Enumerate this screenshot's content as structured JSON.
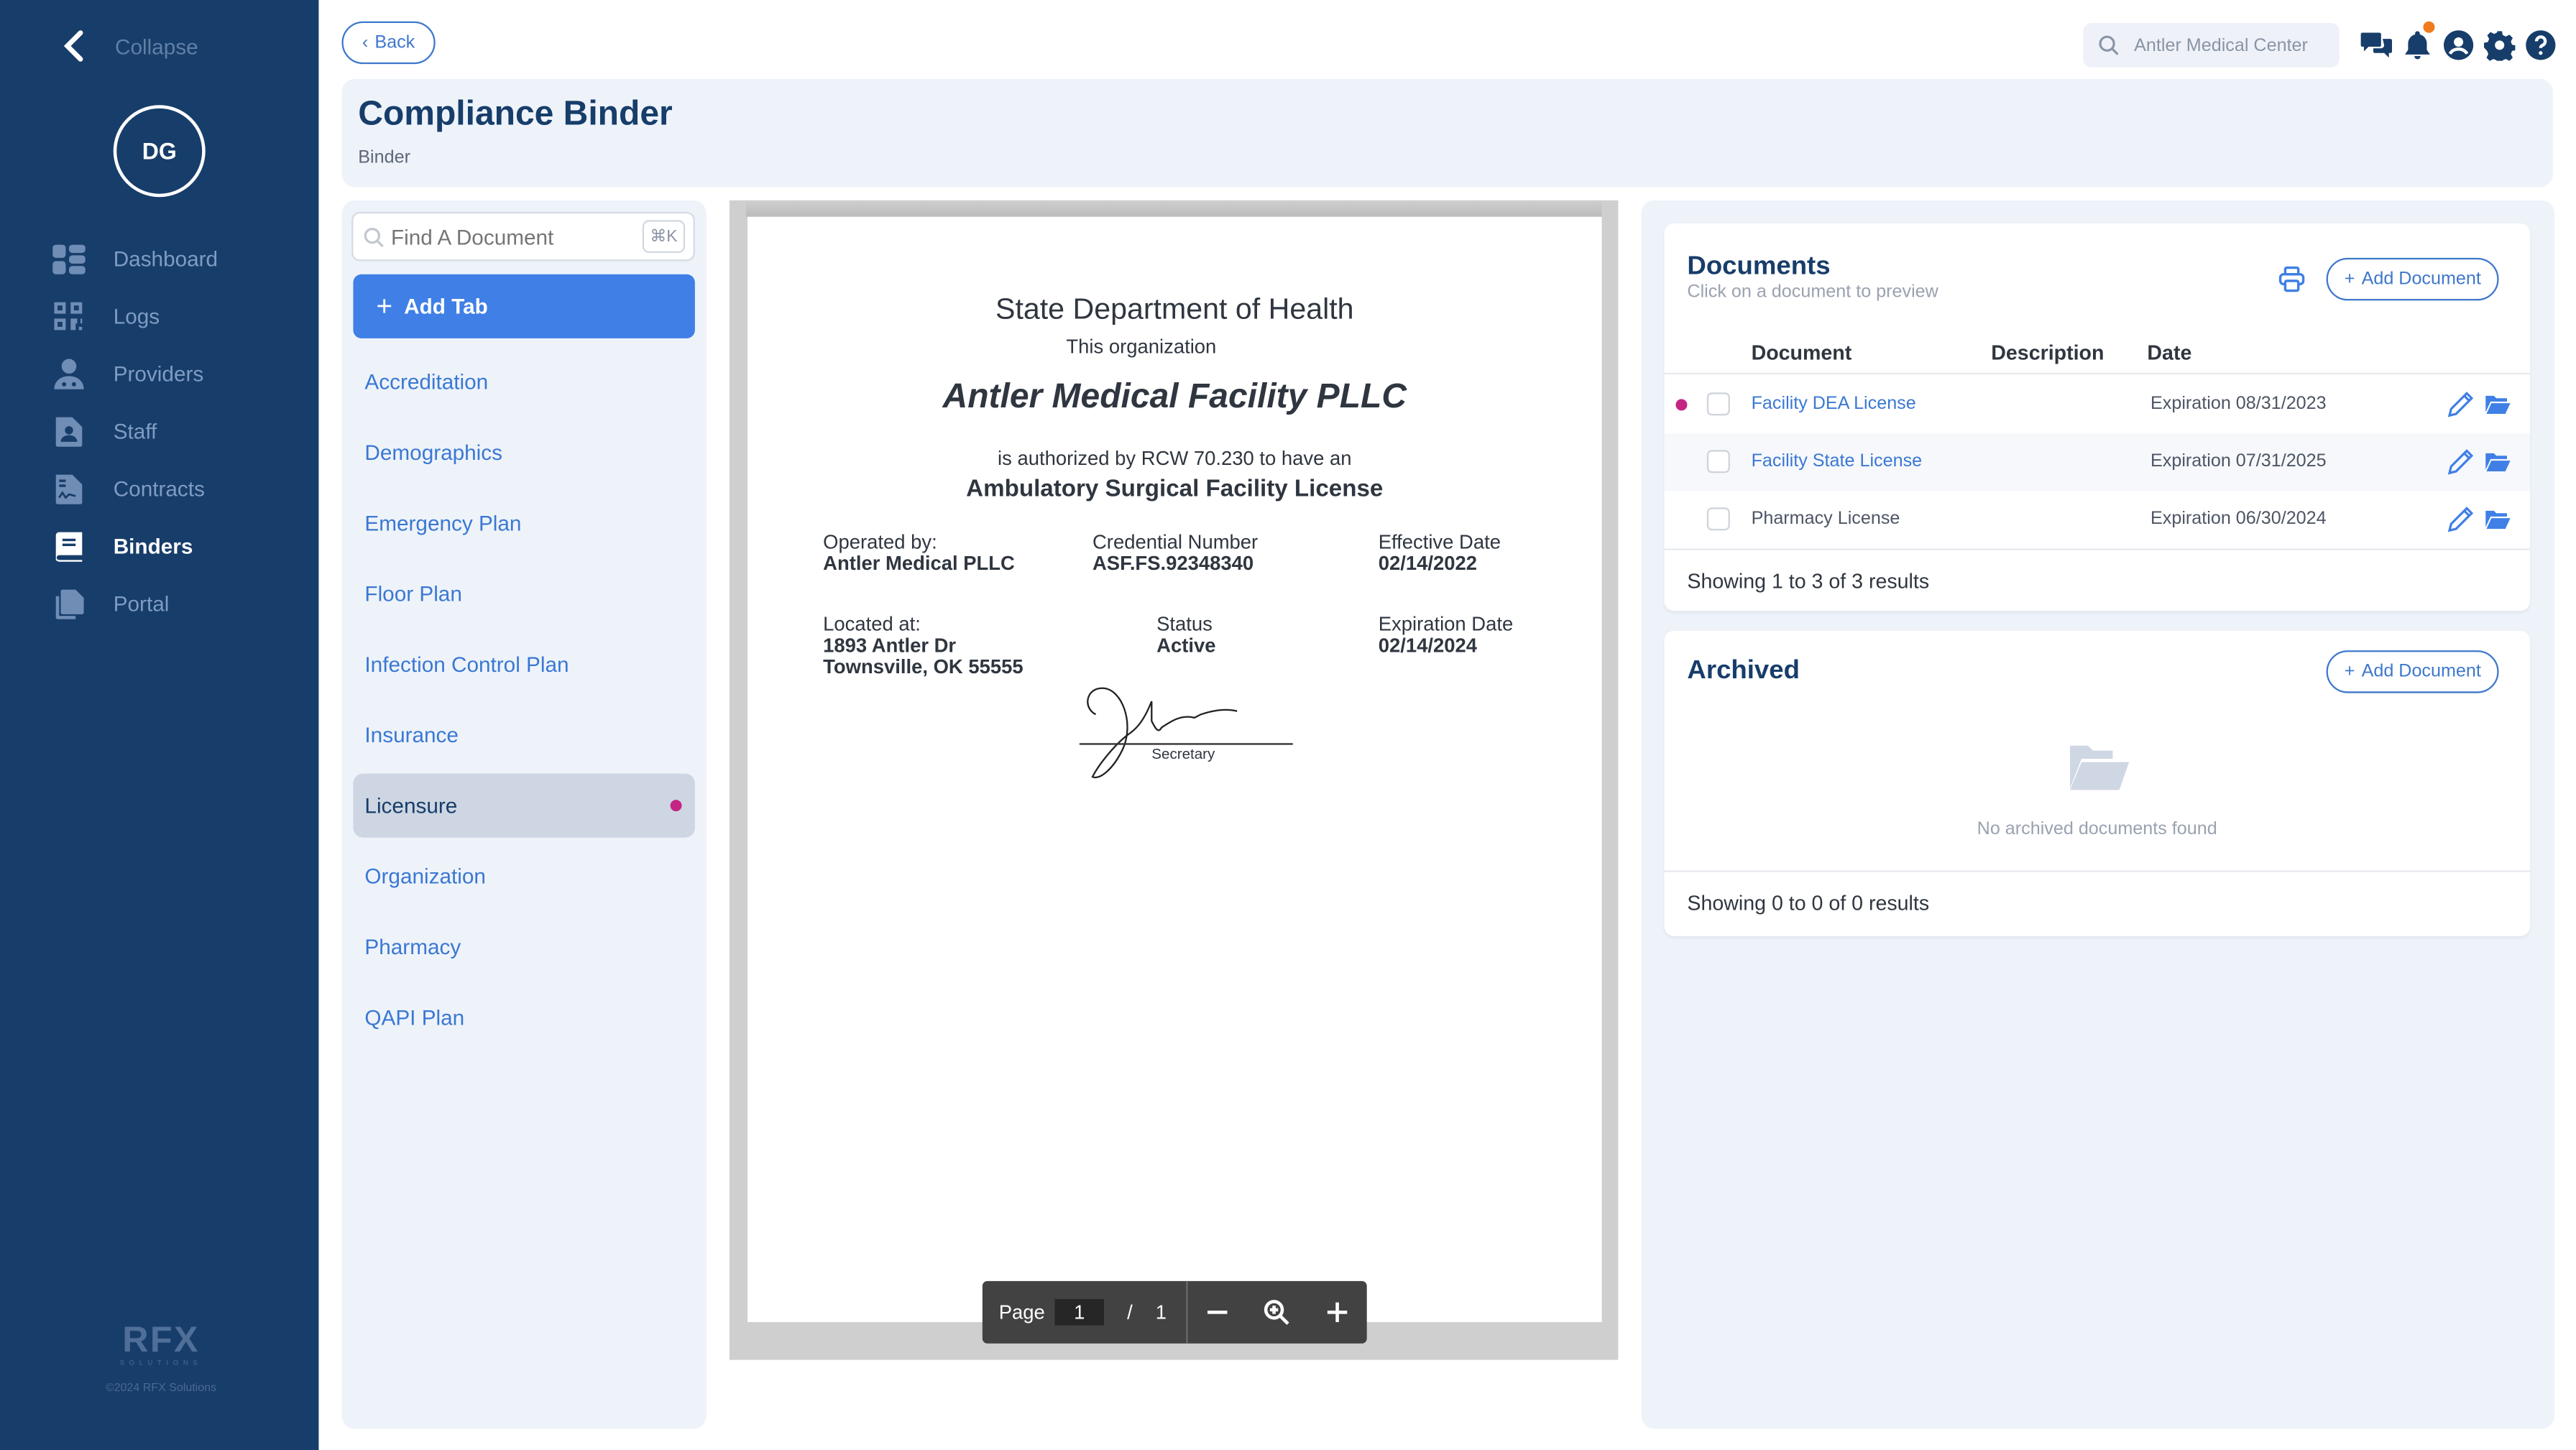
{
  "sidebar": {
    "collapse_label": "Collapse",
    "avatar_initials": "DG",
    "items": [
      {
        "label": "Dashboard",
        "icon": "dashboard-icon",
        "active": false
      },
      {
        "label": "Logs",
        "icon": "qr-code-icon",
        "active": false
      },
      {
        "label": "Providers",
        "icon": "doctor-icon",
        "active": false
      },
      {
        "label": "Staff",
        "icon": "file-user-icon",
        "active": false
      },
      {
        "label": "Contracts",
        "icon": "file-signature-icon",
        "active": false
      },
      {
        "label": "Binders",
        "icon": "book-icon",
        "active": true
      },
      {
        "label": "Portal",
        "icon": "copy-icon",
        "active": false
      }
    ],
    "logo_text": "RFX",
    "logo_subtext": "SOLUTIONS",
    "copyright": "©2024 RFX Solutions"
  },
  "topbar": {
    "back_label": "Back",
    "search_value": "Antler Medical Center",
    "icons": [
      "chat-icon",
      "bell-icon",
      "user-circle-icon",
      "gear-icon",
      "help-icon"
    ],
    "notification_color": "#f07b1c"
  },
  "header": {
    "title": "Compliance Binder",
    "subtitle": "Binder"
  },
  "tabs_panel": {
    "search_placeholder": "Find A Document",
    "shortcut": "⌘K",
    "add_tab_label": "Add Tab",
    "tabs": [
      {
        "label": "Accreditation",
        "active": false,
        "dot": false
      },
      {
        "label": "Demographics",
        "active": false,
        "dot": false
      },
      {
        "label": "Emergency Plan",
        "active": false,
        "dot": false
      },
      {
        "label": "Floor Plan",
        "active": false,
        "dot": false
      },
      {
        "label": "Infection Control Plan",
        "active": false,
        "dot": false
      },
      {
        "label": "Insurance",
        "active": false,
        "dot": false
      },
      {
        "label": "Licensure",
        "active": true,
        "dot": true
      },
      {
        "label": "Organization",
        "active": false,
        "dot": false
      },
      {
        "label": "Pharmacy",
        "active": false,
        "dot": false
      },
      {
        "label": "QAPI Plan",
        "active": false,
        "dot": false
      }
    ]
  },
  "document_preview": {
    "title": "State Department of Health",
    "intro": "This organization",
    "organization_name": "Antler Medical Facility PLLC",
    "authorization": "is authorized by RCW 70.230 to have an",
    "license_type": "Ambulatory Surgical Facility License",
    "fields": {
      "operated_by_label": "Operated by:",
      "operated_by": "Antler Medical PLLC",
      "credential_label": "Credential Number",
      "credential": "ASF.FS.92348340",
      "effective_label": "Effective Date",
      "effective": "02/14/2022",
      "located_label": "Located at:",
      "address_line1": "1893 Antler Dr",
      "address_line2": "Townsville, OK 55555",
      "status_label": "Status",
      "status": "Active",
      "expiration_label": "Expiration Date",
      "expiration": "02/14/2024"
    },
    "signature_label": "Secretary",
    "toolbar": {
      "page_label": "Page",
      "current_page": "1",
      "separator": "/",
      "total_pages": "1"
    }
  },
  "documents": {
    "title": "Documents",
    "hint": "Click on a document to preview",
    "add_label": "Add Document",
    "columns": [
      "Document",
      "Description",
      "Date"
    ],
    "rows": [
      {
        "name": "Facility DEA License",
        "description": "",
        "date": "Expiration 08/31/2023",
        "link": true,
        "dot": true
      },
      {
        "name": "Facility State License",
        "description": "",
        "date": "Expiration 07/31/2025",
        "link": true,
        "dot": false
      },
      {
        "name": "Pharmacy License",
        "description": "",
        "date": "Expiration 06/30/2024",
        "link": false,
        "dot": false
      }
    ],
    "footer": "Showing 1 to 3 of 3 results"
  },
  "archived": {
    "title": "Archived",
    "add_label": "Add Document",
    "empty_text": "No archived documents found",
    "footer": "Showing 0 to 0 of 0 results"
  },
  "colors": {
    "sidebar": "#173d6a",
    "accent": "#3f7fe6",
    "dot": "#c42585"
  }
}
